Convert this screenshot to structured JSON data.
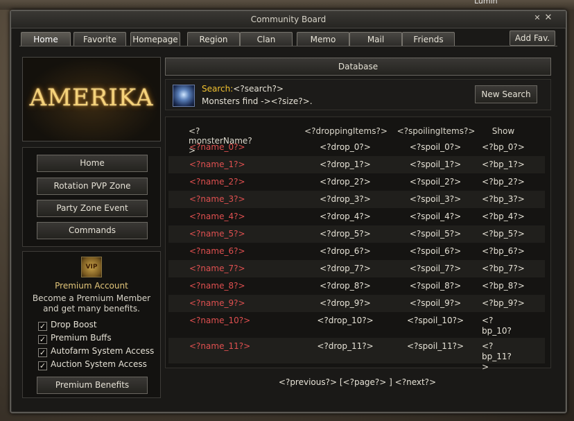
{
  "background": {
    "character_name": "Lumin"
  },
  "window": {
    "title": "Community Board",
    "minimize_glyph": "✕",
    "close_glyph": "✕"
  },
  "tabs": [
    {
      "label": "Home",
      "active": true
    },
    {
      "label": "Favorite"
    },
    {
      "label": "Homepage"
    },
    {
      "label": "Region"
    },
    {
      "label": "Clan"
    },
    {
      "label": "Memo"
    },
    {
      "label": "Mail"
    },
    {
      "label": "Friends"
    }
  ],
  "add_fav": "Add Fav.",
  "logo": {
    "text": "AMERIKA"
  },
  "sidebar": {
    "buttons": [
      {
        "label": "Home"
      },
      {
        "label": "Rotation PVP Zone"
      },
      {
        "label": "Party Zone Event"
      },
      {
        "label": "Commands"
      }
    ]
  },
  "premium": {
    "icon_label": "VIP",
    "title": "Premium Account",
    "description": "Become a Premium Member and get many benefits.",
    "features": [
      {
        "label": "Drop Boost",
        "checked": true
      },
      {
        "label": "Premium Buffs",
        "checked": true
      },
      {
        "label": "Autofarm System Access",
        "checked": true
      },
      {
        "label": "Auction System Access",
        "checked": true
      }
    ],
    "button": "Premium Benefits"
  },
  "database": {
    "header": "Database",
    "search_label": "Search:",
    "search_value": "<?search?>",
    "result_line": "Monsters find -><?size?>.",
    "new_search": "New Search",
    "columns": [
      "<?monsterName?>",
      "<?droppingItems?>",
      "<?spoilingItems?>",
      "Show"
    ],
    "rows": [
      {
        "name": "<?name_0?>",
        "drop": "<?drop_0?>",
        "spoil": "<?spoil_0?>",
        "bp": "<?bp_0?>"
      },
      {
        "name": "<?name_1?>",
        "drop": "<?drop_1?>",
        "spoil": "<?spoil_1?>",
        "bp": "<?bp_1?>"
      },
      {
        "name": "<?name_2?>",
        "drop": "<?drop_2?>",
        "spoil": "<?spoil_2?>",
        "bp": "<?bp_2?>"
      },
      {
        "name": "<?name_3?>",
        "drop": "<?drop_3?>",
        "spoil": "<?spoil_3?>",
        "bp": "<?bp_3?>"
      },
      {
        "name": "<?name_4?>",
        "drop": "<?drop_4?>",
        "spoil": "<?spoil_4?>",
        "bp": "<?bp_4?>"
      },
      {
        "name": "<?name_5?>",
        "drop": "<?drop_5?>",
        "spoil": "<?spoil_5?>",
        "bp": "<?bp_5?>"
      },
      {
        "name": "<?name_6?>",
        "drop": "<?drop_6?>",
        "spoil": "<?spoil_6?>",
        "bp": "<?bp_6?>"
      },
      {
        "name": "<?name_7?>",
        "drop": "<?drop_7?>",
        "spoil": "<?spoil_7?>",
        "bp": "<?bp_7?>"
      },
      {
        "name": "<?name_8?>",
        "drop": "<?drop_8?>",
        "spoil": "<?spoil_8?>",
        "bp": "<?bp_8?>"
      },
      {
        "name": "<?name_9?>",
        "drop": "<?drop_9?>",
        "spoil": "<?spoil_9?>",
        "bp": "<?bp_9?>"
      },
      {
        "name": "<?name_10?>",
        "drop": "<?drop_10?>",
        "spoil": "<?spoil_10?>",
        "bp": "<?bp_10?>"
      },
      {
        "name": "<?name_11?>",
        "drop": "<?drop_11?>",
        "spoil": "<?spoil_11?>",
        "bp": "<?bp_11?>"
      }
    ],
    "pager": "<?previous?> [<?page?> ] <?next?>"
  },
  "colors": {
    "accent": "#f2c230",
    "monster_name": "#e05050",
    "premium_title": "#e3c67a"
  }
}
